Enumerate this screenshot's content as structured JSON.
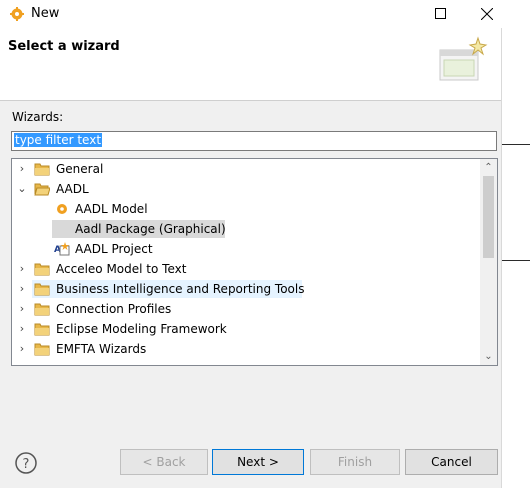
{
  "window": {
    "title": "New"
  },
  "banner": {
    "title": "Select a wizard"
  },
  "wizards": {
    "label": "Wizards:",
    "filter_value": "type filter text"
  },
  "tree": [
    {
      "label": "General",
      "expander": "›",
      "icon": "folder-icon"
    },
    {
      "label": "AADL",
      "expander": "⌄",
      "icon": "folder-open-icon"
    },
    {
      "label": "AADL Model",
      "icon": "aadl-model-icon"
    },
    {
      "label": "Aadl Package (Graphical)",
      "icon": "none",
      "selected": true
    },
    {
      "label": "AADL Project",
      "icon": "aadl-project-icon"
    },
    {
      "label": "Acceleo Model to Text",
      "expander": "›",
      "icon": "folder-icon"
    },
    {
      "label": "Business Intelligence and Reporting Tools",
      "expander": "›",
      "icon": "folder-icon",
      "hovered": true
    },
    {
      "label": "Connection Profiles",
      "expander": "›",
      "icon": "folder-icon"
    },
    {
      "label": "Eclipse Modeling Framework",
      "expander": "›",
      "icon": "folder-icon"
    },
    {
      "label": "EMFTA Wizards",
      "expander": "›",
      "icon": "folder-icon"
    }
  ],
  "buttons": {
    "back": "< Back",
    "next": "Next >",
    "finish": "Finish",
    "cancel": "Cancel"
  },
  "colors": {
    "selection": "#d9d9d9",
    "hover": "#e5f3ff",
    "filter_highlight": "#3399ff",
    "folder": "#e8b84a"
  }
}
